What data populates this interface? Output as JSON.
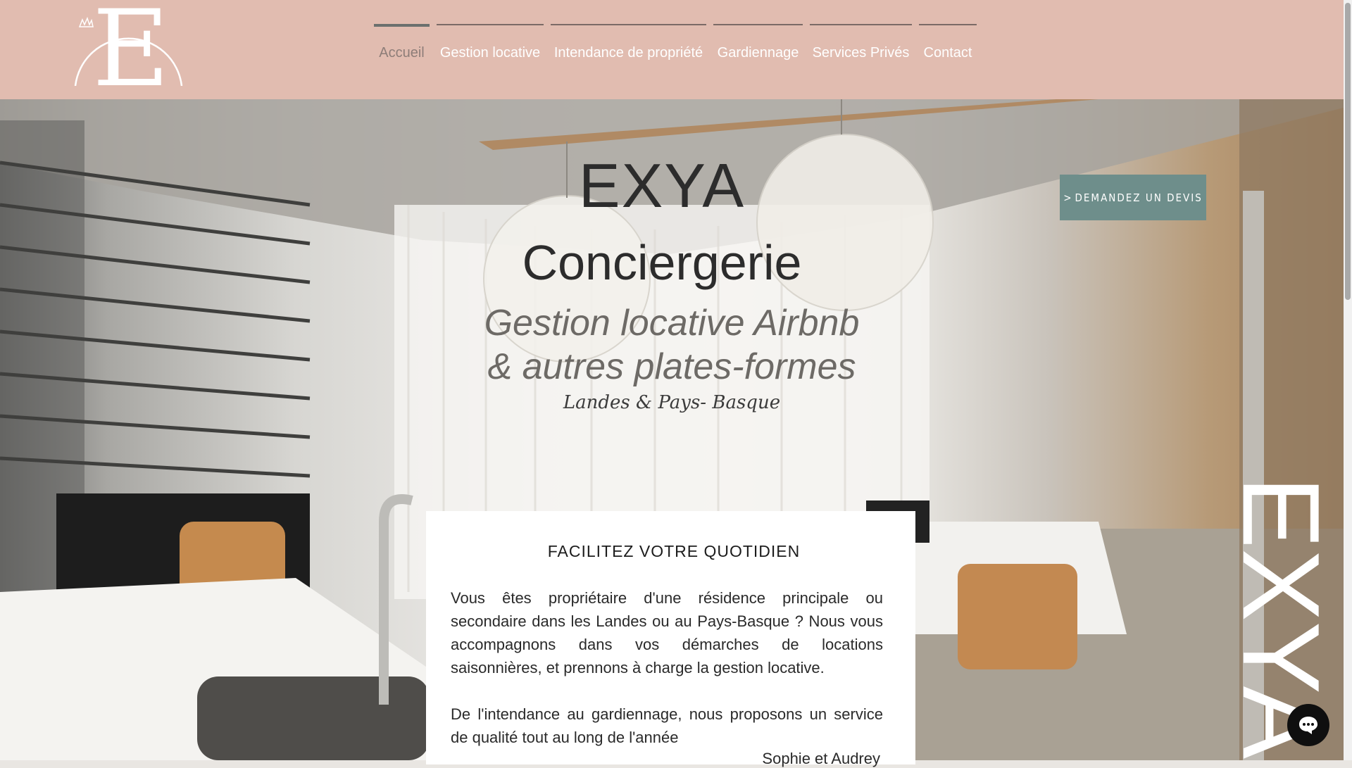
{
  "nav": {
    "items": [
      {
        "label": "Accueil",
        "active": true
      },
      {
        "label": "Gestion locative",
        "active": false
      },
      {
        "label": "Intendance de propriété",
        "active": false
      },
      {
        "label": "Gardiennage",
        "active": false
      },
      {
        "label": "Services Privés",
        "active": false
      },
      {
        "label": "Contact",
        "active": false
      }
    ]
  },
  "logo": {
    "letter": "E"
  },
  "hero": {
    "title": "EXYA",
    "subtitle": "Conciergerie",
    "tagline_1": "Gestion locative Airbnb",
    "tagline_2": "& autres plates-formes",
    "region": "Landes & Pays- Basque",
    "quote_button": "DEMANDEZ UN DEVIS",
    "vertical_brand": "EXYA"
  },
  "card": {
    "title": "FACILITEZ VOTRE QUOTIDIEN",
    "paragraph_1": "Vous êtes propriétaire d'une résidence principale ou secondaire dans les Landes ou au Pays-Basque ? Nous vous accompagnons dans vos démarches de locations saisonnières, et prennons à charge la gestion locative.",
    "paragraph_2": "De l'intendance au gardiennage, nous proposons un service de qualité tout au long de l'année",
    "signature": "Sophie et Audrey"
  },
  "colors": {
    "header_bg": "#e1bcb0",
    "button_bg": "#6e8e8b",
    "active_nav": "#8d7d78"
  },
  "icons": {
    "chat": "chat-bubble-icon",
    "chevron": "chevron-right-icon"
  }
}
